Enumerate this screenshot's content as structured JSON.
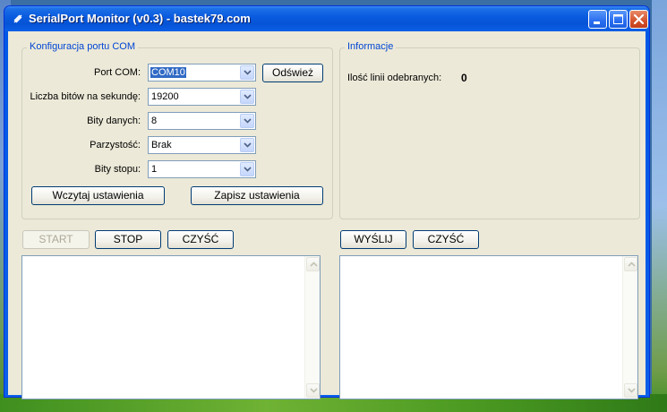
{
  "window": {
    "title": "SerialPort Monitor (v0.3) - bastek79.com"
  },
  "config": {
    "legend": "Konfiguracja portu COM",
    "port_label": "Port COM:",
    "port_value": "COM10",
    "baud_label": "Liczba bitów na sekundę:",
    "baud_value": "19200",
    "databits_label": "Bity danych:",
    "databits_value": "8",
    "parity_label": "Parzystość:",
    "parity_value": "Brak",
    "stopbits_label": "Bity stopu:",
    "stopbits_value": "1",
    "refresh_label": "Odśwież",
    "load_label": "Wczytaj ustawienia",
    "save_label": "Zapisz ustawienia"
  },
  "info": {
    "legend": "Informacje",
    "lines_label": "Ilość linii odebranych:",
    "lines_value": "0"
  },
  "receive": {
    "start_label": "START",
    "stop_label": "STOP",
    "clear_label": "CZYŚĆ"
  },
  "send": {
    "send_label": "WYŚLIJ",
    "clear_label": "CZYŚĆ"
  },
  "colors": {
    "titlebar": "#0a5ce0",
    "legend": "#0046d5",
    "client": "#ece9d8",
    "selection": "#316ac5"
  }
}
